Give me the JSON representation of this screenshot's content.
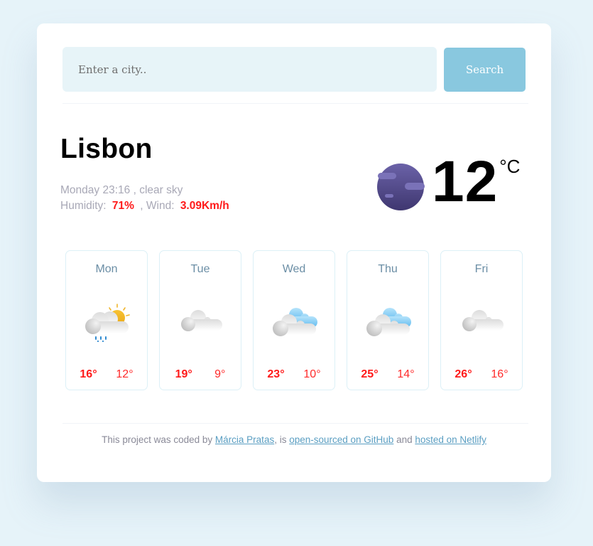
{
  "search": {
    "placeholder": "Enter a city..",
    "value": "",
    "button_label": "Search"
  },
  "current": {
    "city": "Lisbon",
    "day_time": "Monday 23:16",
    "description": "clear sky",
    "humidity_label": "Humidity:",
    "humidity": "71%",
    "wind_label": ", Wind:",
    "wind": "3.09Km/h",
    "temperature": "12",
    "unit": "°C",
    "icon": "clear-night-moon-icon"
  },
  "forecast": [
    {
      "day": "Mon",
      "max": "16°",
      "min": "12°",
      "icon": "partly-sunny-rain-icon"
    },
    {
      "day": "Tue",
      "max": "19°",
      "min": "9°",
      "icon": "cloud-icon"
    },
    {
      "day": "Wed",
      "max": "23°",
      "min": "10°",
      "icon": "broken-clouds-icon"
    },
    {
      "day": "Thu",
      "max": "25°",
      "min": "14°",
      "icon": "broken-clouds-icon"
    },
    {
      "day": "Fri",
      "max": "26°",
      "min": "16°",
      "icon": "cloud-icon"
    }
  ],
  "footer": {
    "text_1": "This project was coded by ",
    "author_link": "Márcia Pratas",
    "text_2": ", is ",
    "github_link": "open-sourced on GitHub",
    "text_3": " and ",
    "netlify_link": "hosted on Netlify"
  },
  "colors": {
    "accent": "#89c8df",
    "highlight": "#ff1a1a",
    "background": "#e6f3f9"
  }
}
